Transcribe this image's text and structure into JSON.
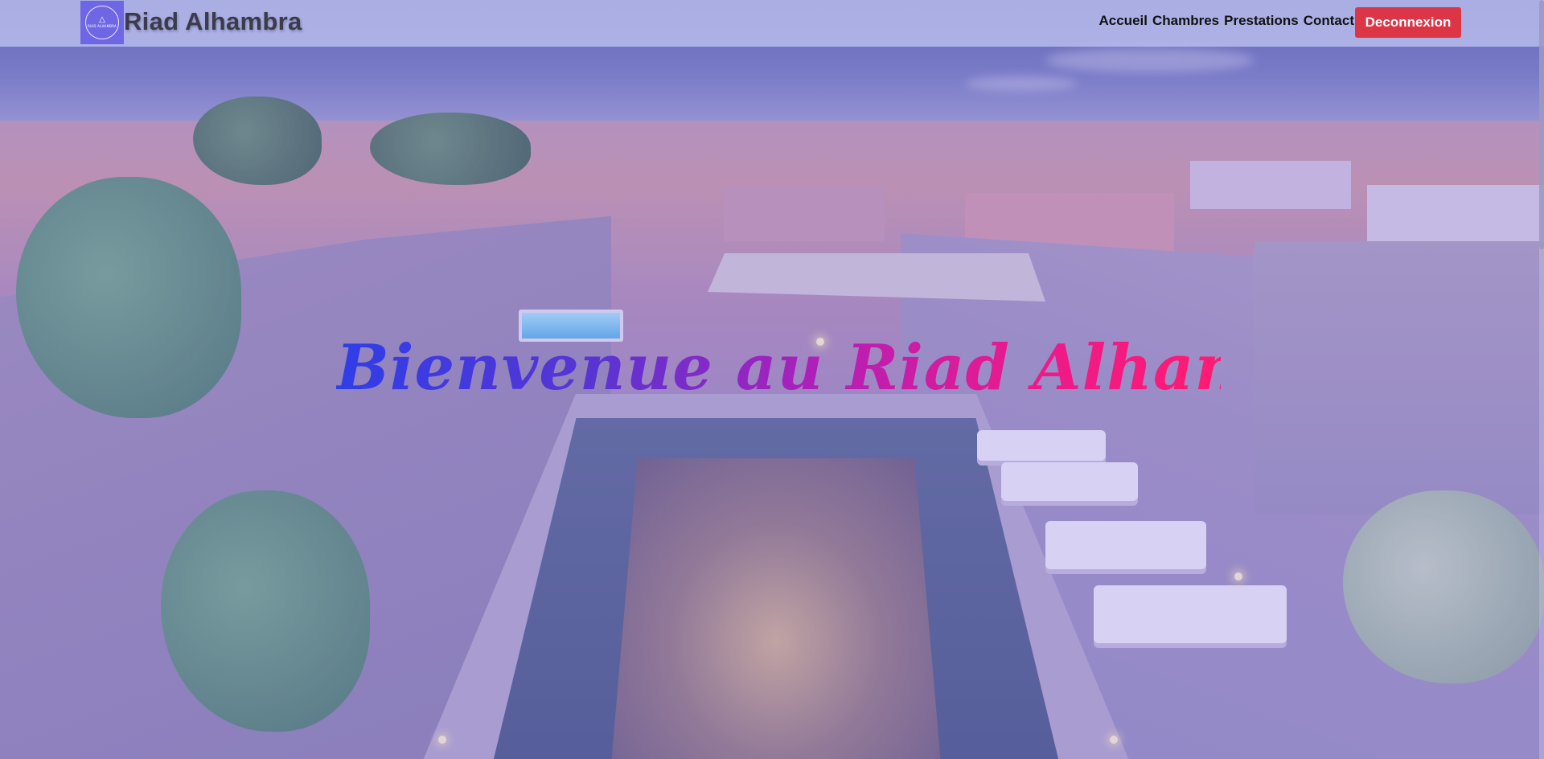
{
  "header": {
    "brand": "Riad Alhambra",
    "logo_text": "RIAD ALHAMBRA",
    "nav": [
      {
        "label": "Accueil"
      },
      {
        "label": "Chambres"
      },
      {
        "label": "Prestations"
      },
      {
        "label": "Contact"
      }
    ],
    "logout_label": "Deconnexion"
  },
  "hero": {
    "title": "Bienvenue au Riad Alhambra",
    "image_description": "rooftop-terrace-marrakech"
  },
  "colors": {
    "logout": "#dc3545",
    "logo_bg": "#6f66e6",
    "title_gradient_start": "#2f3ee8",
    "title_gradient_end": "#ff1b72"
  }
}
